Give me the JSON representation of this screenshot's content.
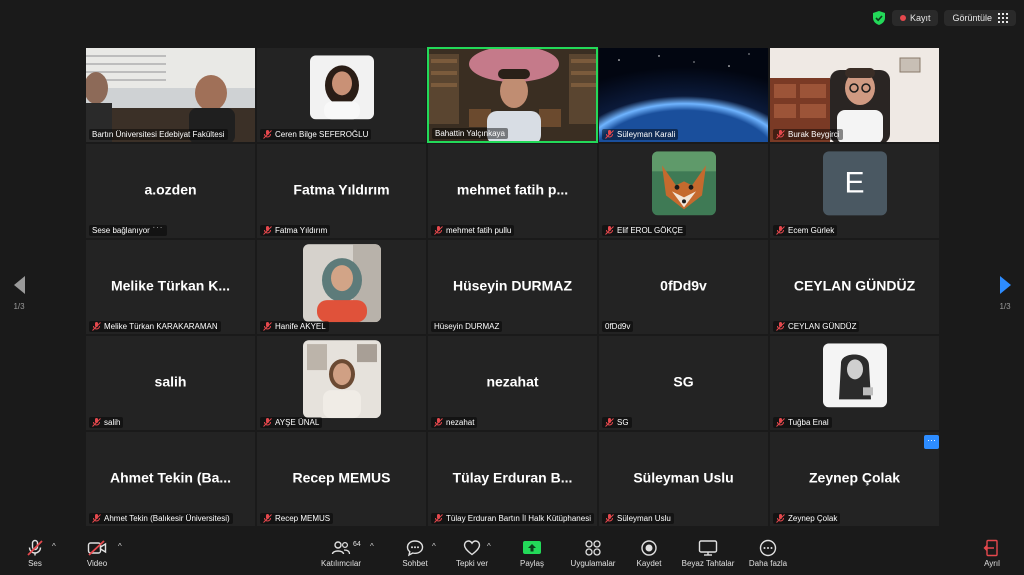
{
  "top": {
    "recording_label": "Kayıt",
    "view_label": "Görüntüle"
  },
  "nav": {
    "left_page": "1/3",
    "right_page": "1/3"
  },
  "tiles": [
    {
      "display": "",
      "label": "Bartın Üniversitesi Edebiyat Fakültesi",
      "muted": false
    },
    {
      "display": "",
      "label": "Ceren Bilge SEFEROĞLU",
      "muted": true
    },
    {
      "display": "",
      "label": "Bahattin Yalçınkaya",
      "muted": false
    },
    {
      "display": "",
      "label": "Süleyman Karali",
      "muted": true
    },
    {
      "display": "",
      "label": "Burak Beygirci",
      "muted": true
    },
    {
      "display": "a.ozden",
      "label": "Sese bağlanıyor",
      "muted": false
    },
    {
      "display": "Fatma Yıldırım",
      "label": "Fatma Yıldırım",
      "muted": true
    },
    {
      "display": "mehmet fatih p...",
      "label": "mehmet fatih pullu",
      "muted": true
    },
    {
      "display": "",
      "label": "Elif EROL GÖKÇE",
      "muted": true
    },
    {
      "display": "E",
      "label": "Ecem Gürlek",
      "muted": true
    },
    {
      "display": "Melike Türkan K...",
      "label": "Melike Türkan KARAKARAMAN",
      "muted": true
    },
    {
      "display": "",
      "label": "Hanife AKYEL",
      "muted": true
    },
    {
      "display": "Hüseyin DURMAZ",
      "label": "Hüseyin DURMAZ",
      "muted": false
    },
    {
      "display": "0fDd9v",
      "label": "0fDd9v",
      "muted": false
    },
    {
      "display": "CEYLAN GÜNDÜZ",
      "label": "CEYLAN GÜNDÜZ",
      "muted": true
    },
    {
      "display": "salih",
      "label": "salih",
      "muted": true
    },
    {
      "display": "",
      "label": "AYŞE ÜNAL",
      "muted": true
    },
    {
      "display": "nezahat",
      "label": "nezahat",
      "muted": true
    },
    {
      "display": "SG",
      "label": "SG",
      "muted": true
    },
    {
      "display": "",
      "label": "Tuğba Enal",
      "muted": true
    },
    {
      "display": "Ahmet Tekin (Ba...",
      "label": "Ahmet Tekin (Balıkesir Üniversitesi)",
      "muted": true
    },
    {
      "display": "Recep MEMUS",
      "label": "Recep MEMUS",
      "muted": true
    },
    {
      "display": "Tülay Erduran B...",
      "label": "Tülay Erduran Bartın İl Halk Kütüphanesi",
      "muted": true
    },
    {
      "display": "Süleyman Uslu",
      "label": "Süleyman Uslu",
      "muted": true
    },
    {
      "display": "Zeynep Çolak",
      "label": "Zeynep Çolak",
      "muted": true
    }
  ],
  "more_label": "···",
  "toolbar": {
    "audio": "Ses",
    "video": "Video",
    "participants": "Katılımcılar",
    "participants_count": "64",
    "chat": "Sohbet",
    "reactions": "Tepki ver",
    "share": "Paylaş",
    "apps": "Uygulamalar",
    "record": "Kaydet",
    "whiteboards": "Beyaz Tahtalar",
    "more": "Daha fazla",
    "leave": "Ayrıl"
  },
  "colors": {
    "active_speaker": "#23d959",
    "accent": "#2d8cff",
    "share": "#23d959",
    "leave": "#e5484d",
    "muted": "#e5484d"
  }
}
